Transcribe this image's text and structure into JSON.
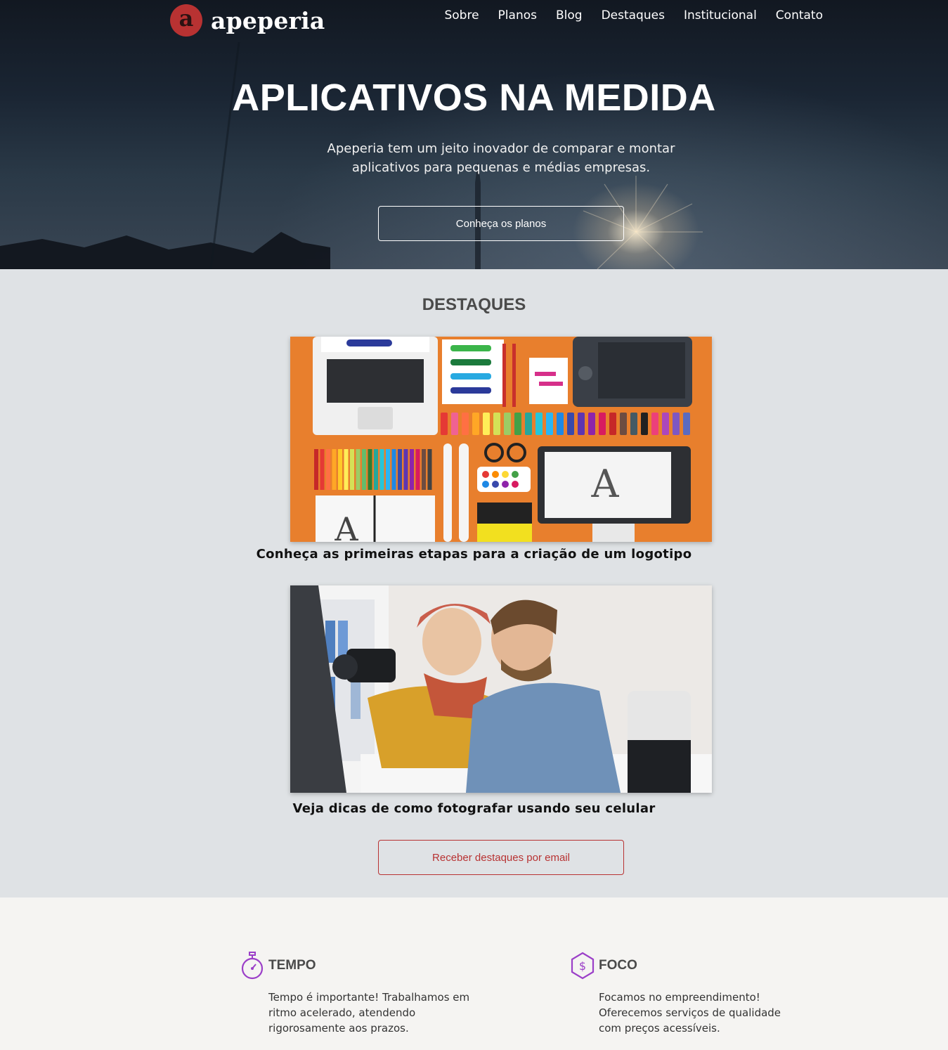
{
  "brand": {
    "mark": "a",
    "name": "apeperia"
  },
  "nav": [
    "Sobre",
    "Planos",
    "Blog",
    "Destaques",
    "Institucional",
    "Contato"
  ],
  "hero": {
    "title": "APLICATIVOS NA MEDIDA",
    "subtitle": "Apeperia tem um jeito inovador de comparar e montar aplicativos para pequenas e médias empresas.",
    "button": "Conheça os planos"
  },
  "destaques": {
    "title": "DESTAQUES",
    "items": [
      {
        "caption": "Conheça as primeiras etapas para a criação de um logotipo"
      },
      {
        "caption": "Veja dicas de como fotografar usando seu celular"
      }
    ],
    "button": "Receber destaques por email"
  },
  "features": [
    {
      "icon": "stopwatch-icon",
      "title": "TEMPO",
      "text": "Tempo é importante! Trabalhamos em ritmo acelerado, atendendo rigorosamente aos prazos."
    },
    {
      "icon": "dollar-hexagon-icon",
      "title": "FOCO",
      "text": "Focamos no empreendimento! Oferecemos serviços de qualidade com preços acessíveis."
    }
  ],
  "colors": {
    "accent": "#b83232",
    "icon": "#9b3fc8",
    "section_bg": "#dfe2e5",
    "footer_bg": "#f5f4f2"
  }
}
